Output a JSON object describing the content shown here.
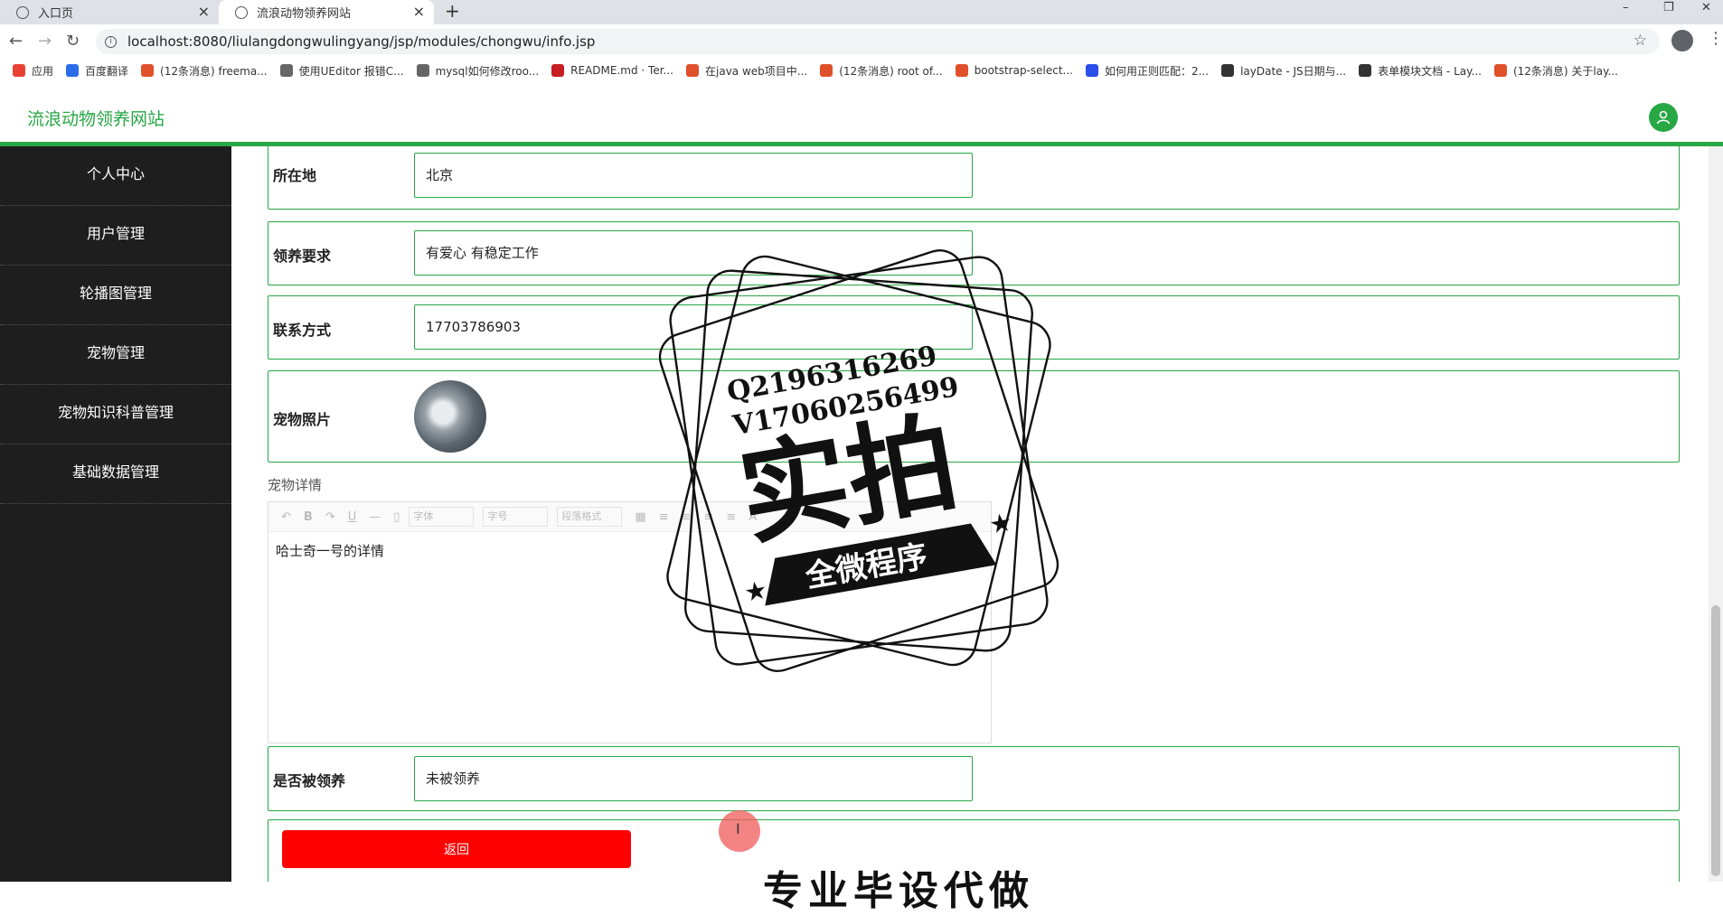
{
  "browser": {
    "tabs": [
      {
        "label": "入口页"
      },
      {
        "label": "流浪动物领养网站"
      }
    ],
    "new_tab": "+",
    "controls": {
      "minimize": "–",
      "restore": "❐",
      "close": "✕"
    },
    "url": "localhost:8080/liulangdongwulingyang/jsp/modules/chongwu/info.jsp",
    "bookmarks": [
      {
        "label": "应用",
        "color": "#e94235"
      },
      {
        "label": "百度翻译",
        "color": "#2b6de8"
      },
      {
        "label": "(12条消息) freema...",
        "color": "#e0502b"
      },
      {
        "label": "使用UEditor 报错C...",
        "color": "#666666"
      },
      {
        "label": "mysql如何修改roo...",
        "color": "#666666"
      },
      {
        "label": "README.md · Ter...",
        "color": "#c71d23"
      },
      {
        "label": "在java web项目中...",
        "color": "#e0502b"
      },
      {
        "label": "(12条消息) root of...",
        "color": "#e0502b"
      },
      {
        "label": "bootstrap-select...",
        "color": "#e0502b"
      },
      {
        "label": "如何用正则匹配：2...",
        "color": "#2b4de8"
      },
      {
        "label": "layDate - JS日期与...",
        "color": "#333333"
      },
      {
        "label": "表单模块文档 - Lay...",
        "color": "#333333"
      },
      {
        "label": "(12条消息) 关于lay...",
        "color": "#e0502b"
      }
    ]
  },
  "app": {
    "title": "流浪动物领养网站",
    "accent": "#28a745"
  },
  "sidebar": {
    "items": [
      {
        "label": "个人中心"
      },
      {
        "label": "用户管理"
      },
      {
        "label": "轮播图管理"
      },
      {
        "label": "宠物管理"
      },
      {
        "label": "宠物知识科普管理"
      },
      {
        "label": "基础数据管理"
      }
    ]
  },
  "form": {
    "location": {
      "label": "所在地",
      "value": "北京"
    },
    "requirement": {
      "label": "领养要求",
      "value": "有爱心  有稳定工作"
    },
    "contact": {
      "label": "联系方式",
      "value": "17703786903"
    },
    "photo": {
      "label": "宠物照片"
    },
    "detail": {
      "label": "宠物详情",
      "toolbar": {
        "font": "字体",
        "size": "字号",
        "paragraph": "段落格式"
      },
      "content": "哈士奇一号的详情"
    },
    "adopted": {
      "label": "是否被领养",
      "value": "未被领养"
    },
    "return_label": "返回"
  },
  "watermark": {
    "line1": "Q2196316269",
    "line2": "V17060256499",
    "big": "实拍",
    "banner": "全微程序",
    "bottom": "专业毕设代做"
  }
}
